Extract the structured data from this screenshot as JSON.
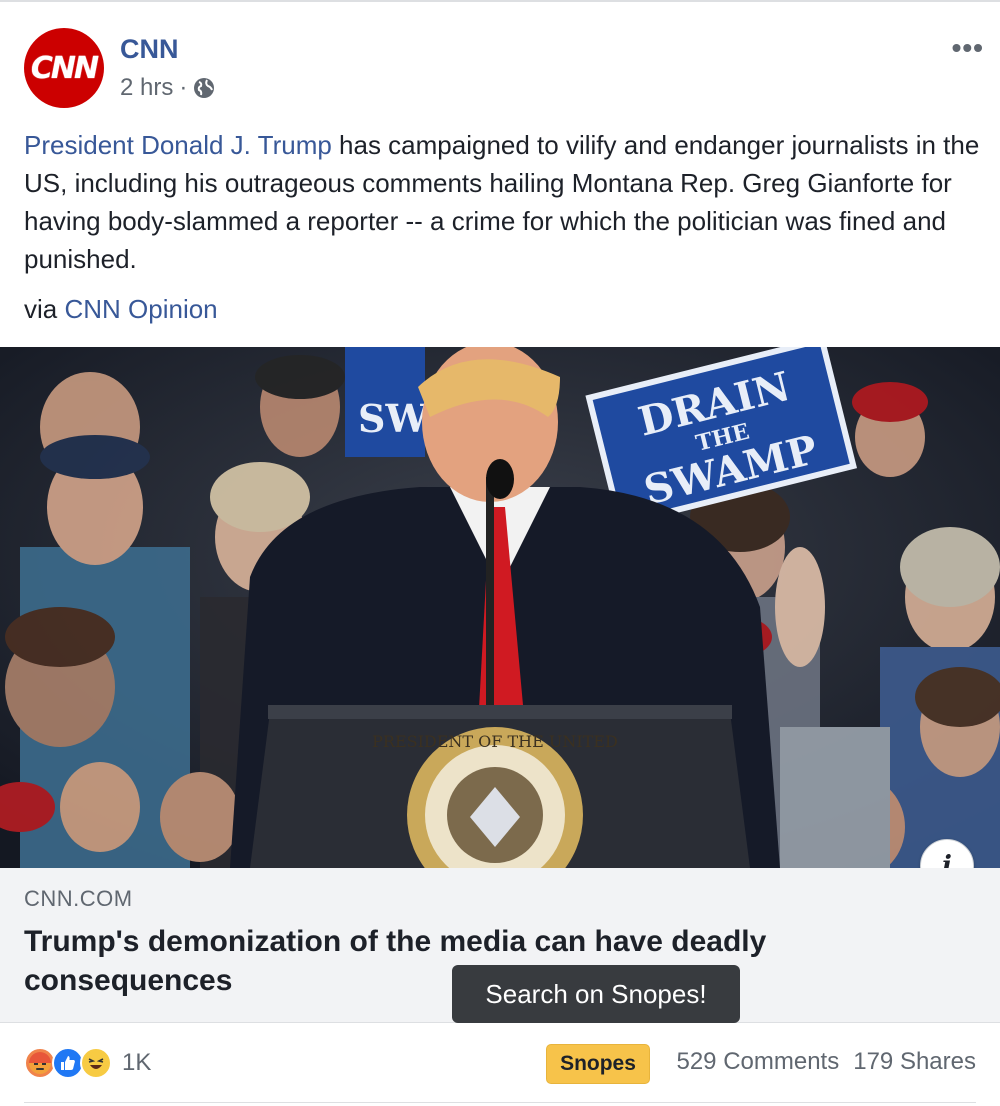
{
  "post": {
    "page_name": "CNN",
    "avatar_label": "CNN",
    "timestamp": "2 hrs",
    "separator": "·",
    "privacy_icon": "globe-icon",
    "more_label": "•••",
    "text_link": "President Donald J. Trump",
    "text_body": " has campaigned to vilify and endanger journalists in the US, including his outrageous comments hailing Montana Rep. Greg Gianforte for having body-slammed a reporter -- a crime for which the politician was fined and punished.",
    "via_prefix": "via ",
    "via_link": "CNN Opinion"
  },
  "image": {
    "sign_text_1": "DRAIN",
    "sign_text_2": "THE",
    "sign_text_3": "SWAMP",
    "sign_left_text": "SW",
    "seal_text": "PRESIDENT OF THE UNITED"
  },
  "preview": {
    "domain": "CNN.COM",
    "headline": "Trump's demonization of the media can have deadly consequences",
    "info_icon": "i"
  },
  "tooltip": {
    "text": "Search on Snopes!"
  },
  "footer": {
    "reaction_icons": [
      "angry-icon",
      "like-icon",
      "haha-icon"
    ],
    "reaction_count": "1K",
    "snopes_label": "Snopes",
    "comments": "529 Comments",
    "shares": "179 Shares"
  },
  "colors": {
    "link": "#385898",
    "cnn_red": "#cc0000",
    "snopes_yellow": "#f7c34a",
    "tooltip_bg": "#383b3f"
  }
}
